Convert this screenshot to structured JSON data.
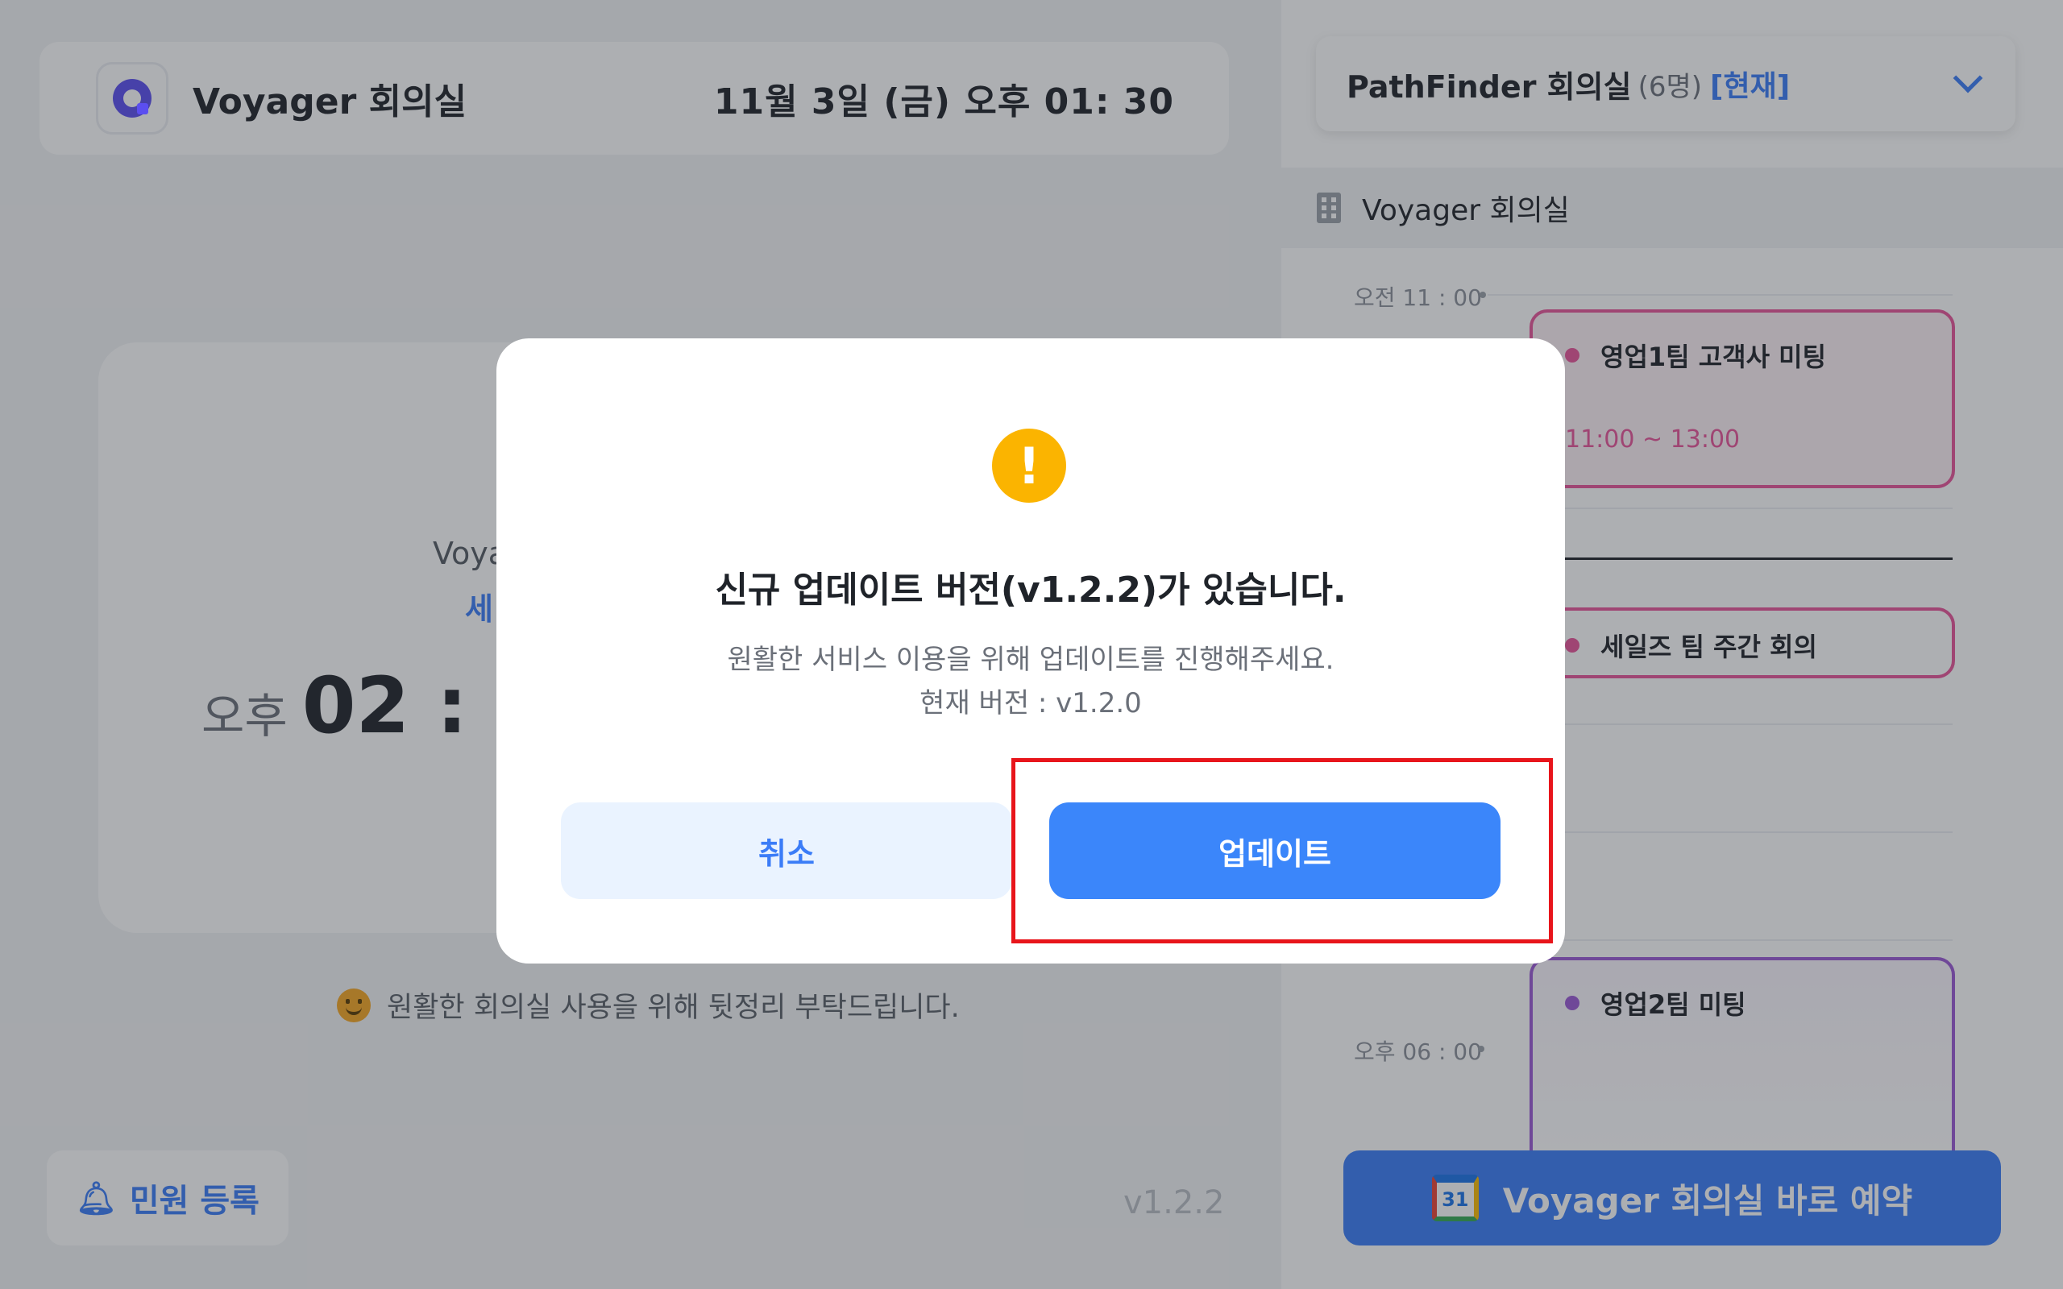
{
  "header": {
    "room_title": "Voyager 회의실",
    "datetime": "11월 3일 (금)  오후 01: 30"
  },
  "status": {
    "room": "Voya",
    "label": "세",
    "ampm": "오후",
    "clock": "02 : 0"
  },
  "notice": "원활한 회의실 사용을 위해 뒷정리 부탁드립니다.",
  "complaint_button": "민원 등록",
  "version_footer": "v1.2.2",
  "room_selector": {
    "name": "PathFinder 회의실",
    "count": "(6명)",
    "current": "[현재]"
  },
  "room_strip": "Voyager 회의실",
  "timeline": {
    "start_time": "오전 11 : 00",
    "end_time": "오후 06 : 00",
    "events": [
      {
        "title": "영업1팀 고객사 미팅",
        "time": "11:00 ~ 13:00"
      },
      {
        "title": "세일즈 팀 주간 회의"
      },
      {
        "title": "영업2팀 미팅"
      }
    ]
  },
  "reserve_button": {
    "label": "Voyager 회의실 바로 예약",
    "calendar_day": "31"
  },
  "modal": {
    "title": "신규 업데이트 버전(v1.2.2)가 있습니다.",
    "desc_line1": "원활한 서비스 이용을 위해 업데이트를 진행해주세요.",
    "desc_line2": "현재 버전 : v1.2.0",
    "cancel_label": "취소",
    "update_label": "업데이트",
    "warn_glyph": "!"
  },
  "colors": {
    "accent": "#3b7cf7",
    "warning": "#fbb400",
    "event_pink": "#e9559a",
    "event_purple": "#9b59d6",
    "highlight": "#e8151b"
  }
}
